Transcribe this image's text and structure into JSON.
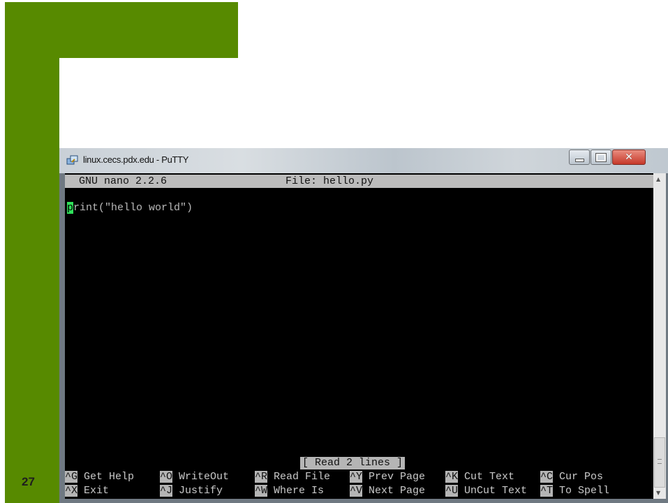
{
  "slide": {
    "page_number": "27",
    "accent_color": "#578a00"
  },
  "window": {
    "title": "linux.cecs.pdx.edu - PuTTY",
    "icon": "putty-icon",
    "buttons": {
      "minimize": "minimize-icon",
      "maximize": "maximize-icon",
      "close": "✕"
    }
  },
  "nano": {
    "version": "GNU nano 2.2.6",
    "file_label": "File: hello.py",
    "code": {
      "cursor_char": "p",
      "rest": "rint(\"hello world\")"
    },
    "status": "[ Read 2 lines ]",
    "shortcuts": [
      [
        {
          "key": "^G",
          "label": "Get Help"
        },
        {
          "key": "^O",
          "label": "WriteOut"
        },
        {
          "key": "^R",
          "label": "Read File"
        },
        {
          "key": "^Y",
          "label": "Prev Page"
        },
        {
          "key": "^K",
          "label": "Cut Text"
        },
        {
          "key": "^C",
          "label": "Cur Pos"
        }
      ],
      [
        {
          "key": "^X",
          "label": "Exit"
        },
        {
          "key": "^J",
          "label": "Justify"
        },
        {
          "key": "^W",
          "label": "Where Is"
        },
        {
          "key": "^V",
          "label": "Next Page"
        },
        {
          "key": "^U",
          "label": "UnCut Text"
        },
        {
          "key": "^T",
          "label": "To Spell"
        }
      ]
    ]
  }
}
